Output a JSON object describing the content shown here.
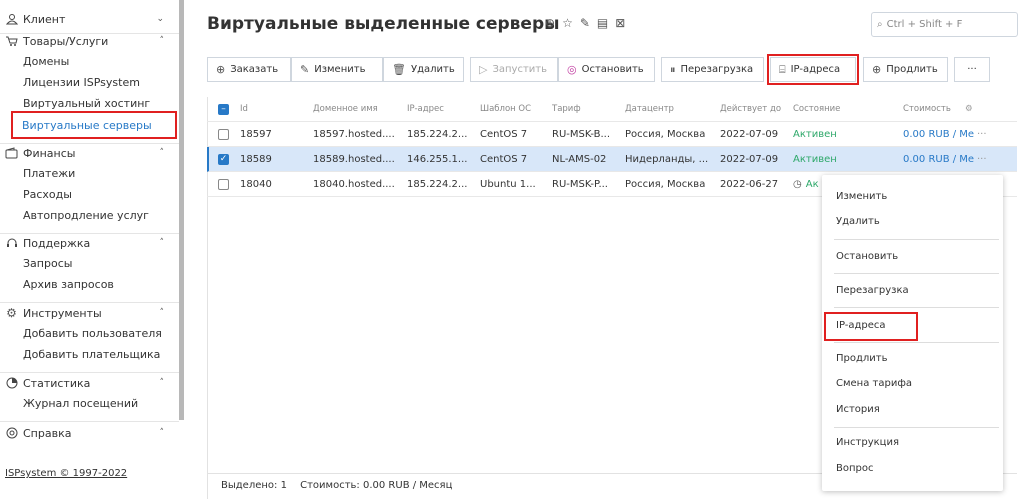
{
  "sidebar": {
    "groups": [
      {
        "label": "Клиент",
        "icon": "user-icon",
        "items": []
      },
      {
        "label": "Товары/Услуги",
        "icon": "cart-icon",
        "items": [
          "Домены",
          "Лицензии ISPsystem",
          "Виртуальный хостинг",
          "Виртуальные серверы"
        ]
      },
      {
        "label": "Финансы",
        "icon": "wallet-icon",
        "items": [
          "Платежи",
          "Расходы",
          "Автопродление услуг"
        ]
      },
      {
        "label": "Поддержка",
        "icon": "headset-icon",
        "items": [
          "Запросы",
          "Архив запросов"
        ]
      },
      {
        "label": "Инструменты",
        "icon": "gear-icon",
        "items": [
          "Добавить пользователя",
          "Добавить плательщика"
        ]
      },
      {
        "label": "Статистика",
        "icon": "pie-chart-icon",
        "items": [
          "Журнал посещений"
        ]
      },
      {
        "label": "Справка",
        "icon": "lifebuoy-icon",
        "items": []
      }
    ],
    "active_item": "Виртуальные серверы",
    "footer": "ISPsystem © 1997-2022"
  },
  "header": {
    "title": "Виртуальные выделенные серверы",
    "search_placeholder": "Ctrl + Shift + F"
  },
  "toolbar": {
    "buttons": [
      "Заказать",
      "Изменить",
      "Удалить",
      "Запустить",
      "Остановить",
      "Перезагрузка",
      "IP-адреса",
      "Продлить",
      "···"
    ]
  },
  "table": {
    "columns": [
      "Id",
      "Доменное имя",
      "IP-адрес",
      "Шаблон ОС",
      "Тариф",
      "Датацентр",
      "Действует до",
      "Состояние",
      "Стоимость"
    ],
    "rows": [
      {
        "id": "18597",
        "domain": "18597.hosted....",
        "ip": "185.224.2...",
        "os": "CentOS 7",
        "tariff": "RU-MSK-B...",
        "dc": "Россия, Москва",
        "until": "2022-07-09",
        "state": "Активен",
        "cost": "0.00 RUB / Ме"
      },
      {
        "id": "18589",
        "domain": "18589.hosted....",
        "ip": "146.255.1...",
        "os": "CentOS 7",
        "tariff": "NL-AMS-02",
        "dc": "Нидерланды, ...",
        "until": "2022-07-09",
        "state": "Активен",
        "cost": "0.00 RUB / Ме"
      },
      {
        "id": "18040",
        "domain": "18040.hosted....",
        "ip": "185.224.2...",
        "os": "Ubuntu 1...",
        "tariff": "RU-MSK-P...",
        "dc": "Россия, Москва",
        "until": "2022-06-27",
        "state": "Ак",
        "cost": ""
      }
    ]
  },
  "footer": {
    "selected": "Выделено: 1",
    "cost": "Стоимость: 0.00 RUB / Месяц"
  },
  "context_menu": {
    "items": [
      "Изменить",
      "Удалить",
      "Остановить",
      "Перезагрузка",
      "IP-адреса",
      "Продлить",
      "Смена тарифа",
      "История",
      "Инструкция",
      "Вопрос"
    ]
  },
  "colors": {
    "accent": "#2779c7",
    "active_status": "#2ea86a",
    "highlight": "#e02020"
  }
}
